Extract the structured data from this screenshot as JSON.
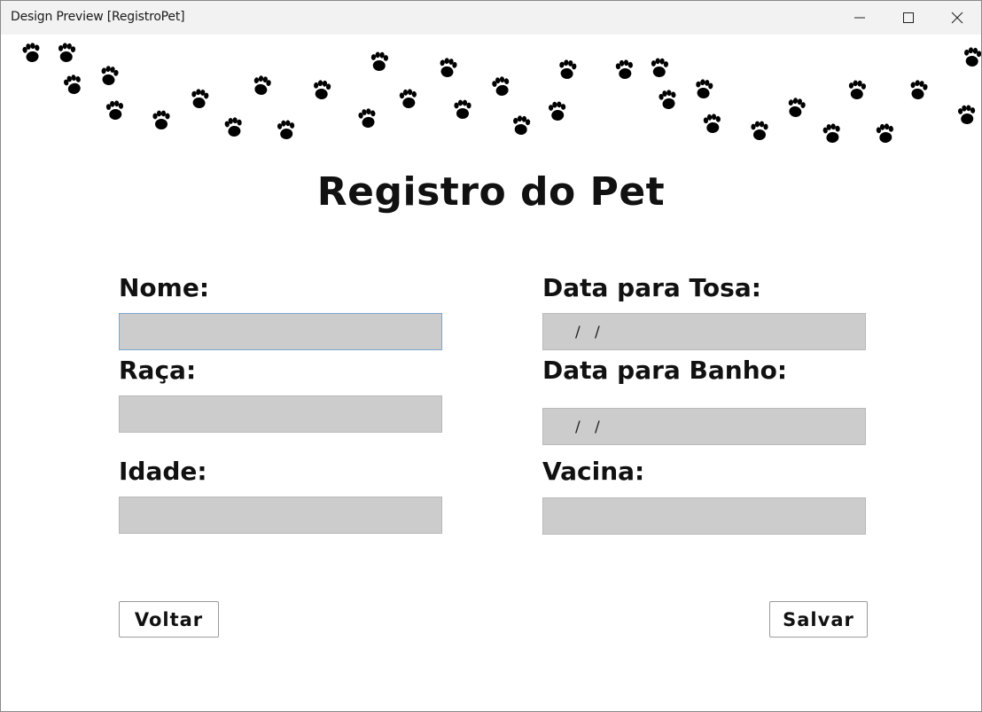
{
  "window": {
    "title": "Design Preview [RegistroPet]"
  },
  "window_controls": [
    "minimize-icon",
    "maximize-icon",
    "close-icon"
  ],
  "decoration": {
    "icon": "paw-print-icon",
    "color": "#000000"
  },
  "form": {
    "heading": "Registro do Pet",
    "left": [
      {
        "label": "Nome:",
        "value": ""
      },
      {
        "label": "Raça:",
        "value": ""
      },
      {
        "label": "Idade:",
        "value": ""
      }
    ],
    "right": [
      {
        "label": "Data para Tosa:",
        "value": "  /  /"
      },
      {
        "label": "Data para Banho:",
        "value": "  /  /"
      },
      {
        "label": "Vacina:",
        "value": ""
      }
    ],
    "date_separator": "/"
  },
  "buttons": {
    "back": "Voltar",
    "save": "Salvar"
  },
  "colors": {
    "field_bg": "#cccccc",
    "focus_border": "#7aa7cf",
    "titlebar_bg": "#f2f2f2"
  }
}
